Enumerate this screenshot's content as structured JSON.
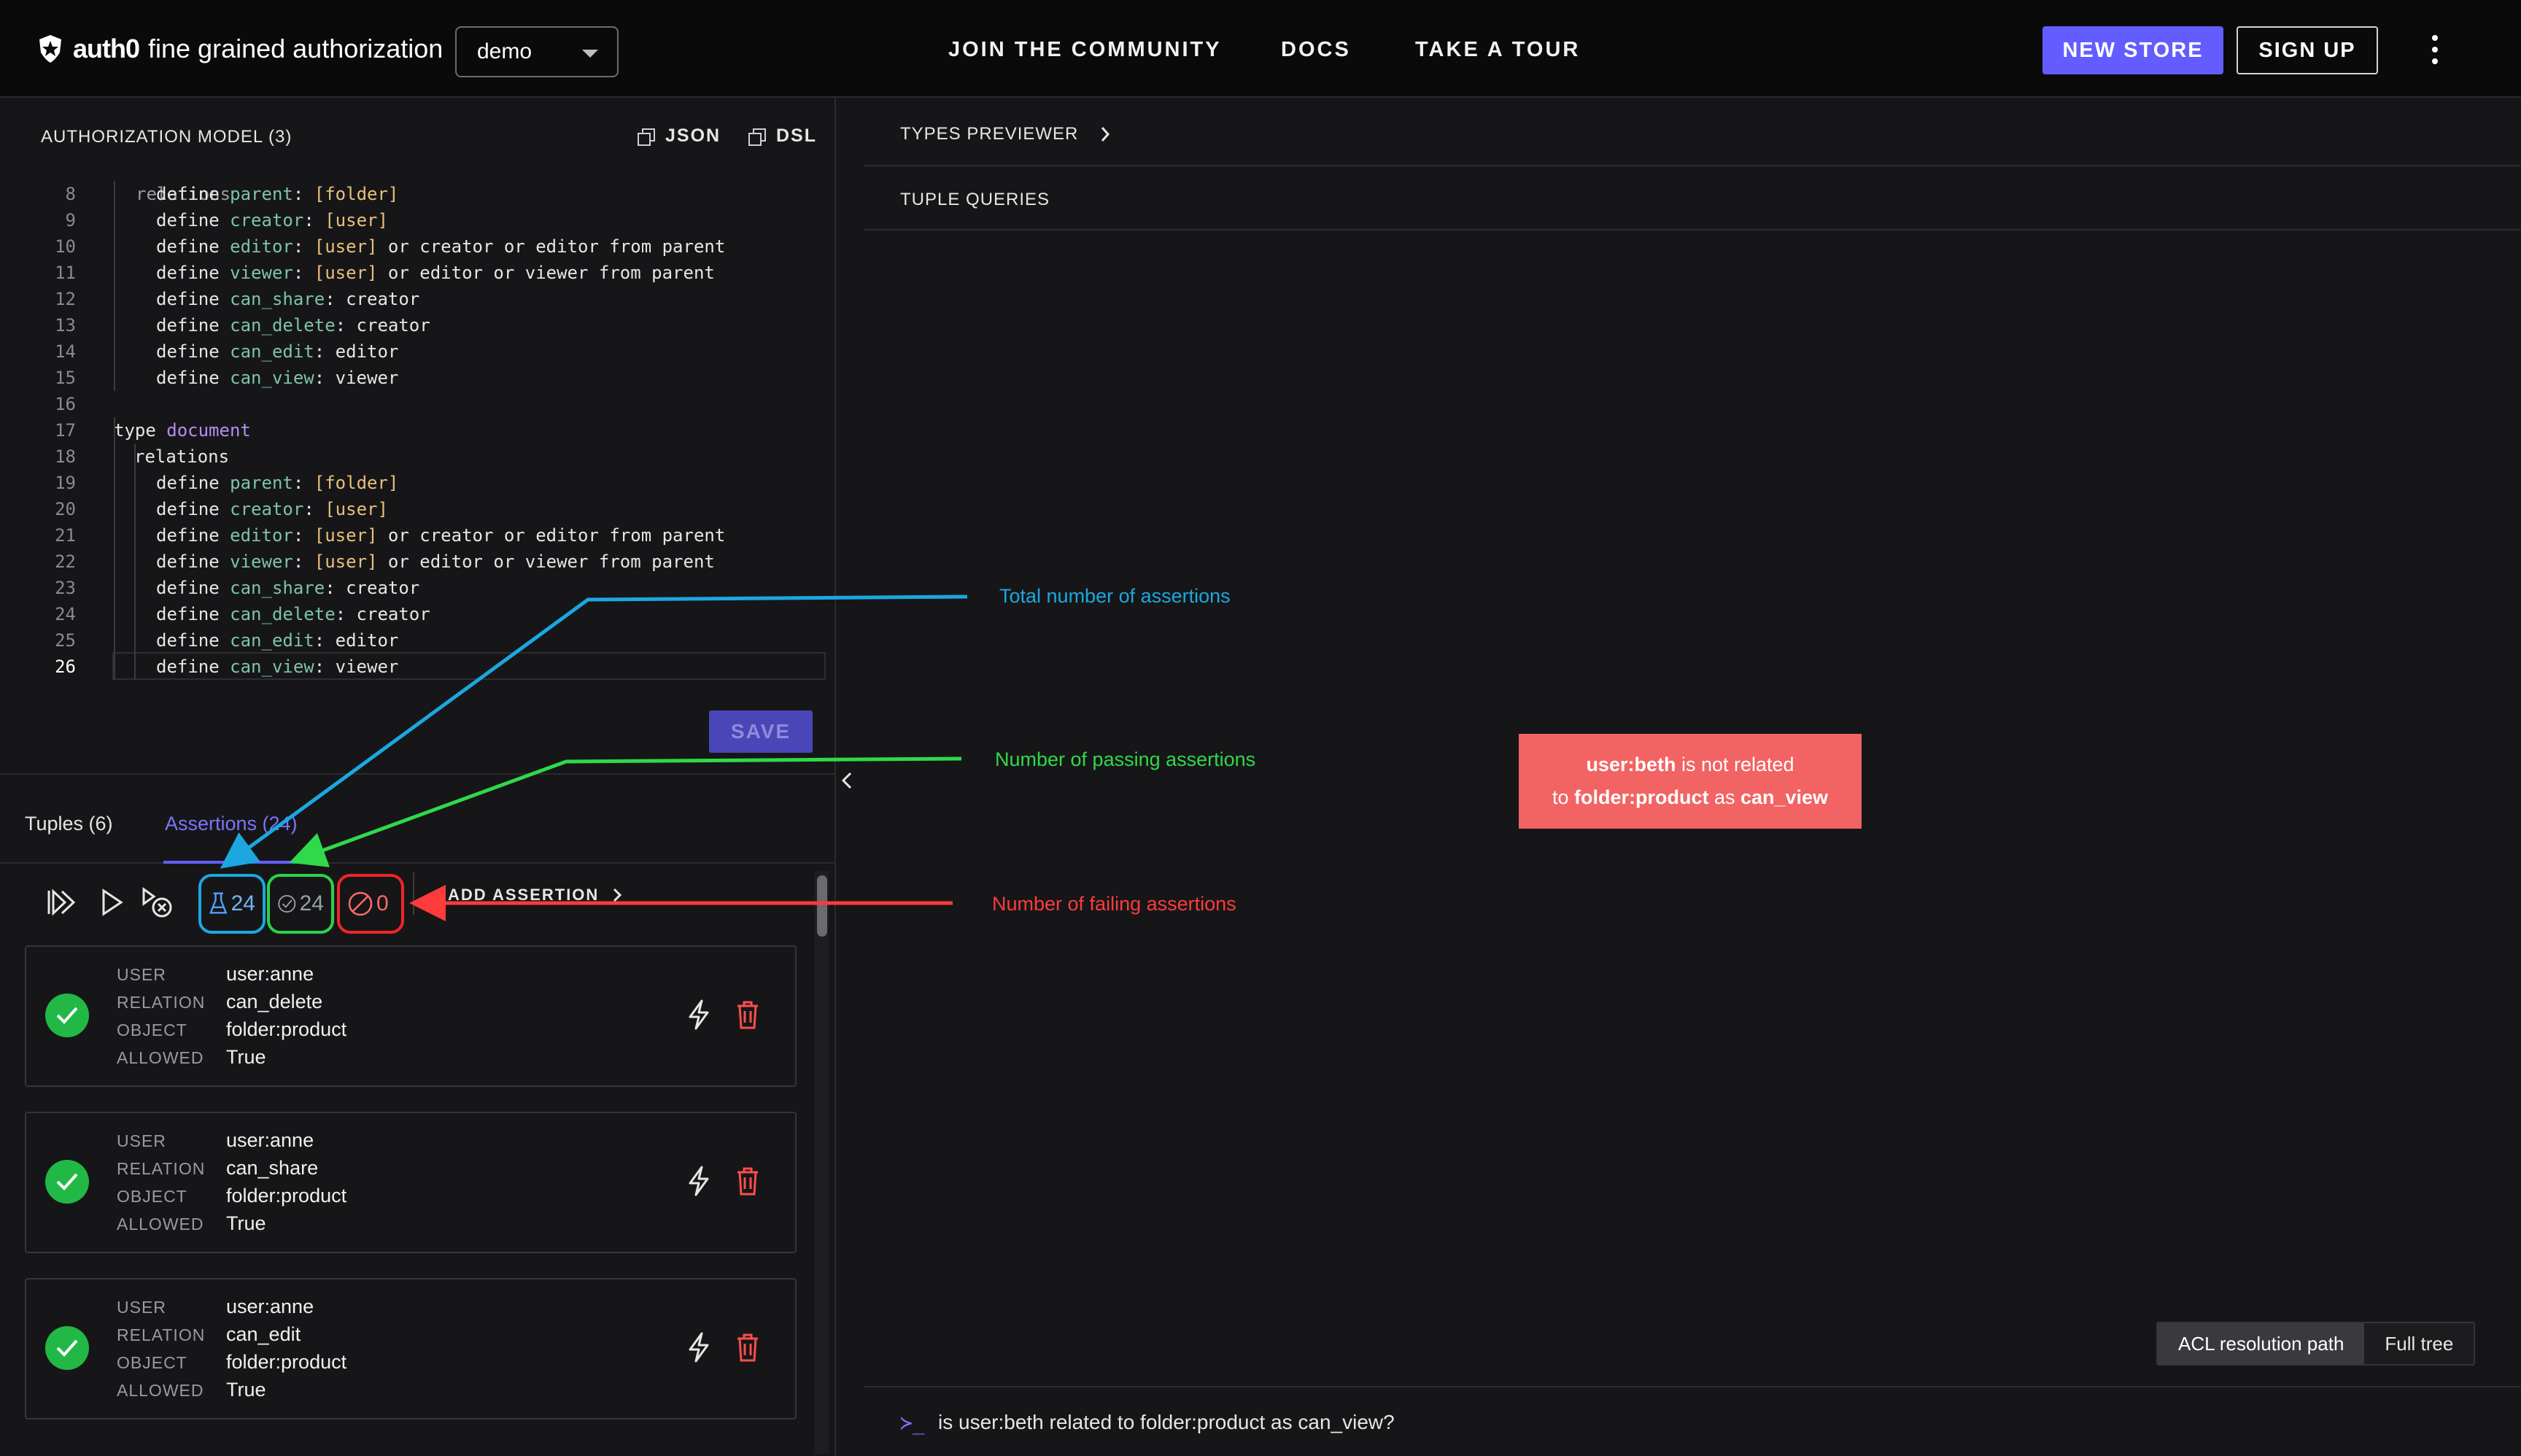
{
  "header": {
    "logo_text": "auth0",
    "product_name": "fine grained authorization",
    "store_selected": "demo",
    "nav": [
      "JOIN THE COMMUNITY",
      "DOCS",
      "TAKE A TOUR"
    ],
    "new_store_label": "NEW STORE",
    "sign_up_label": "SIGN UP"
  },
  "model": {
    "title": "AUTHORIZATION MODEL (3)",
    "json_label": "JSON",
    "dsl_label": "DSL",
    "save_label": "SAVE",
    "partial_top_line": "relations",
    "lines": [
      {
        "n": "8",
        "text": "define parent: [folder]"
      },
      {
        "n": "9",
        "text": "define creator: [user]"
      },
      {
        "n": "10",
        "text": "define editor: [user] or creator or editor from parent"
      },
      {
        "n": "11",
        "text": "define viewer: [user] or editor or viewer from parent"
      },
      {
        "n": "12",
        "text": "define can_share: creator"
      },
      {
        "n": "13",
        "text": "define can_delete: creator"
      },
      {
        "n": "14",
        "text": "define can_edit: editor"
      },
      {
        "n": "15",
        "text": "define can_view: viewer"
      },
      {
        "n": "16",
        "text": ""
      },
      {
        "n": "17",
        "text": "type document"
      },
      {
        "n": "18",
        "text": "relations"
      },
      {
        "n": "19",
        "text": "define parent: [folder]"
      },
      {
        "n": "20",
        "text": "define creator: [user]"
      },
      {
        "n": "21",
        "text": "define editor: [user] or creator or editor from parent"
      },
      {
        "n": "22",
        "text": "define viewer: [user] or editor or viewer from parent"
      },
      {
        "n": "23",
        "text": "define can_share: creator"
      },
      {
        "n": "24",
        "text": "define can_delete: creator"
      },
      {
        "n": "25",
        "text": "define can_edit: editor"
      },
      {
        "n": "26",
        "text": "define can_view: viewer"
      }
    ]
  },
  "tabs": {
    "tuples": "Tuples (6)",
    "assertions": "Assertions (24)"
  },
  "toolbar": {
    "total": "24",
    "passing": "24",
    "failing": "0",
    "add_assertion_label": "ADD ASSERTION"
  },
  "assertion_labels": {
    "user": "USER",
    "relation": "RELATION",
    "object": "OBJECT",
    "allowed": "ALLOWED"
  },
  "assertions": [
    {
      "user": "user:anne",
      "relation": "can_delete",
      "object": "folder:product",
      "allowed": "True"
    },
    {
      "user": "user:anne",
      "relation": "can_share",
      "object": "folder:product",
      "allowed": "True"
    },
    {
      "user": "user:anne",
      "relation": "can_edit",
      "object": "folder:product",
      "allowed": "True"
    }
  ],
  "right": {
    "types_previewer": "TYPES PREVIEWER",
    "tuple_queries": "TUPLE QUERIES",
    "result": {
      "user": "user:beth",
      "middle": " is not related",
      "to": "to ",
      "object": "folder:product",
      "as": " as ",
      "relation": "can_view"
    },
    "acl_label": "ACL resolution path",
    "full_tree_label": "Full tree",
    "query_prompt": "≻_",
    "query_text": "is user:beth related to folder:product as can_view?"
  },
  "annotations": {
    "total": "Total number of assertions",
    "passing": "Number of passing assertions",
    "failing": "Number of failing assertions"
  },
  "colors": {
    "accent": "#635dff",
    "annotation_total": "#1ca7e0",
    "annotation_pass": "#2fd94a",
    "annotation_fail": "#ff3b3b",
    "result_bg": "#f26363",
    "check": "#22b845"
  }
}
